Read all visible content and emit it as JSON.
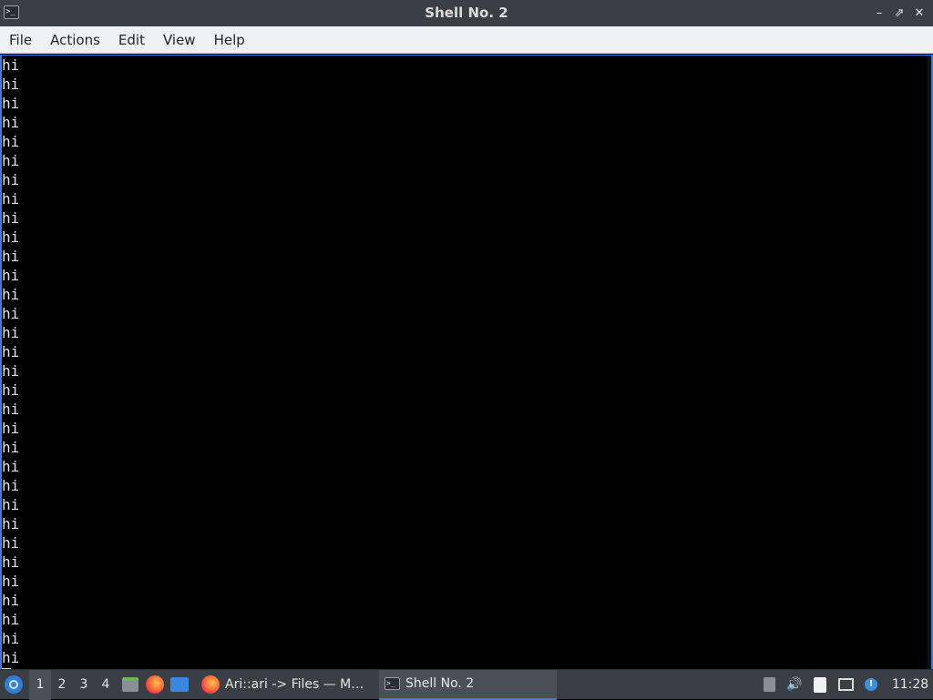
{
  "window": {
    "title": "Shell No. 2",
    "app_icon": "terminal-icon",
    "controls": [
      "minimize-icon",
      "restore-icon",
      "close-icon"
    ]
  },
  "menubar": {
    "items": [
      "File",
      "Actions",
      "Edit",
      "View",
      "Help"
    ]
  },
  "terminal": {
    "lines": [
      "hi",
      "hi",
      "hi",
      "hi",
      "hi",
      "hi",
      "hi",
      "hi",
      "hi",
      "hi",
      "hi",
      "hi",
      "hi",
      "hi",
      "hi",
      "hi",
      "hi",
      "hi",
      "hi",
      "hi",
      "hi",
      "hi",
      "hi",
      "hi",
      "hi",
      "hi",
      "hi",
      "hi",
      "hi",
      "hi",
      "hi",
      "hi"
    ],
    "cursor_line": "hi",
    "colors": {
      "background": "#000000",
      "foreground": "#e3e3e3",
      "focus_border": "#3d7ddf"
    }
  },
  "taskbar": {
    "desktops": [
      "1",
      "2",
      "3",
      "4"
    ],
    "active_desktop": "1",
    "quicklaunch": [
      "files-icon",
      "firefox-icon",
      "show-desktop-icon"
    ],
    "tasks": [
      {
        "label": "Ari::ari -> Files — Mozi…",
        "icon": "firefox-icon",
        "active": false
      },
      {
        "label": "Shell No. 2",
        "icon": "terminal-icon",
        "active": true
      }
    ],
    "tray": [
      "removable-media-icon",
      "volume-icon",
      "clipboard-icon",
      "network-icon",
      "update-notifier-icon"
    ],
    "clock": "11:28"
  }
}
